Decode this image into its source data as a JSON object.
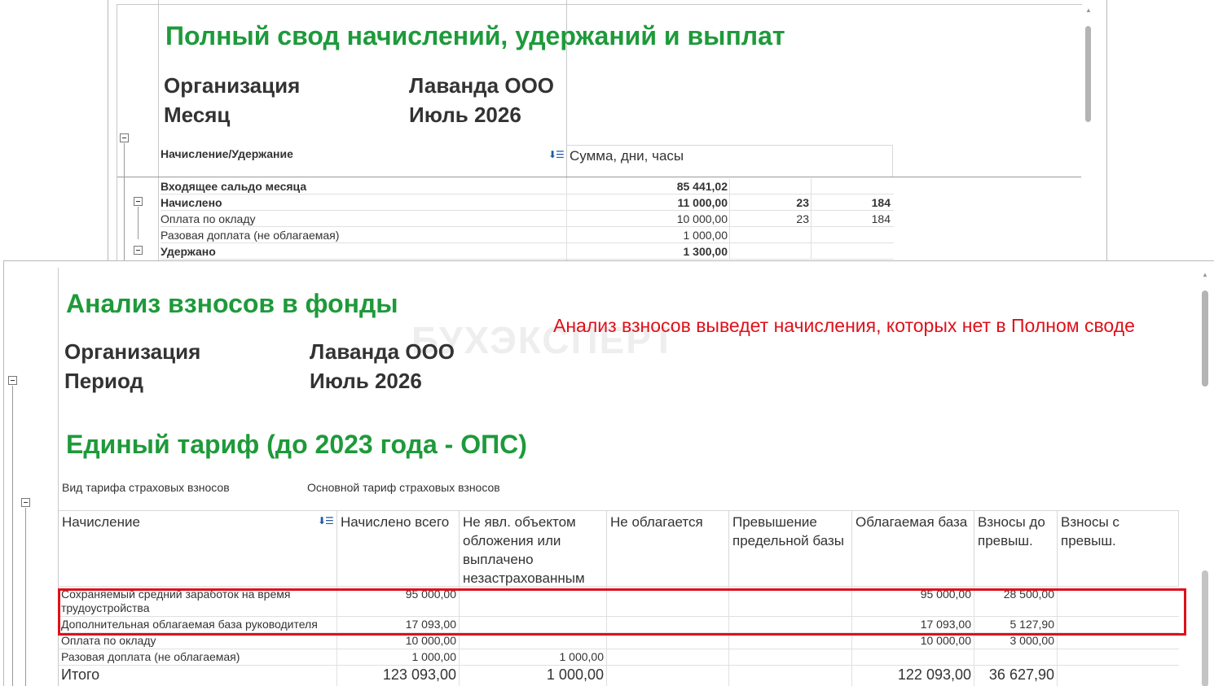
{
  "report1": {
    "title": "Полный свод начислений, удержаний и выплат",
    "params": [
      {
        "label": "Организация",
        "value": "Лаванда ООО"
      },
      {
        "label": "Месяц",
        "value": "Июль 2026"
      }
    ],
    "column_header_left": "Начисление/Удержание",
    "column_header_right": "Сумма, дни, часы",
    "rows": [
      {
        "name": "Входящее сальдо месяца",
        "sum": "85 441,02",
        "days": "",
        "hours": "",
        "bold": true
      },
      {
        "name": "Начислено",
        "sum": "11 000,00",
        "days": "23",
        "hours": "184",
        "bold": true
      },
      {
        "name": "Оплата по окладу",
        "sum": "10 000,00",
        "days": "23",
        "hours": "184",
        "bold": false
      },
      {
        "name": "Разовая доплата (не облагаемая)",
        "sum": "1 000,00",
        "days": "",
        "hours": "",
        "bold": false
      },
      {
        "name": "Удержано",
        "sum": "1 300,00",
        "days": "",
        "hours": "",
        "bold": true
      }
    ]
  },
  "report2": {
    "title": "Анализ взносов в фонды",
    "annotation": "Анализ взносов выведет начисления, которых нет в Полном своде",
    "watermark": "БУХЭКСПЕРТ",
    "params": [
      {
        "label": "Организация",
        "value": "Лаванда ООО"
      },
      {
        "label": "Период",
        "value": "Июль 2026"
      }
    ],
    "section_title": "Единый тариф (до 2023 года - ОПС)",
    "tariff_label": "Вид тарифа страховых взносов",
    "tariff_value": "Основной тариф страховых взносов",
    "columns": [
      "Начисление",
      "Начислено всего",
      "Не явл. объектом обложения или выплачено незастрахованным",
      "Не облагается",
      "Превышение предельной базы",
      "Облагаемая база",
      "Взносы до превыш.",
      "Взносы с превыш."
    ],
    "rows": [
      {
        "name": "Сохраняемый средний заработок на время трудоустройства",
        "total": "95 000,00",
        "not_object": "",
        "not_taxed": "",
        "over_limit": "",
        "base": "95 000,00",
        "before": "28 500,00",
        "after": ""
      },
      {
        "name": "Дополнительная облагаемая база руководителя",
        "total": "17 093,00",
        "not_object": "",
        "not_taxed": "",
        "over_limit": "",
        "base": "17 093,00",
        "before": "5 127,90",
        "after": ""
      },
      {
        "name": "Оплата по окладу",
        "total": "10 000,00",
        "not_object": "",
        "not_taxed": "",
        "over_limit": "",
        "base": "10 000,00",
        "before": "3 000,00",
        "after": ""
      },
      {
        "name": "Разовая доплата (не облагаемая)",
        "total": "1 000,00",
        "not_object": "1 000,00",
        "not_taxed": "",
        "over_limit": "",
        "base": "",
        "before": "",
        "after": ""
      }
    ],
    "totals": {
      "name": "Итого",
      "total": "123 093,00",
      "not_object": "1 000,00",
      "not_taxed": "",
      "over_limit": "",
      "base": "122 093,00",
      "before": "36 627,90",
      "after": ""
    }
  },
  "colors": {
    "title_green": "#1e9a3a",
    "annotation_red": "#e0101a",
    "sort_icon_blue": "#1e5aa8"
  },
  "icons": [
    "collapse-icon",
    "sort-icon",
    "scroll-up-icon"
  ]
}
